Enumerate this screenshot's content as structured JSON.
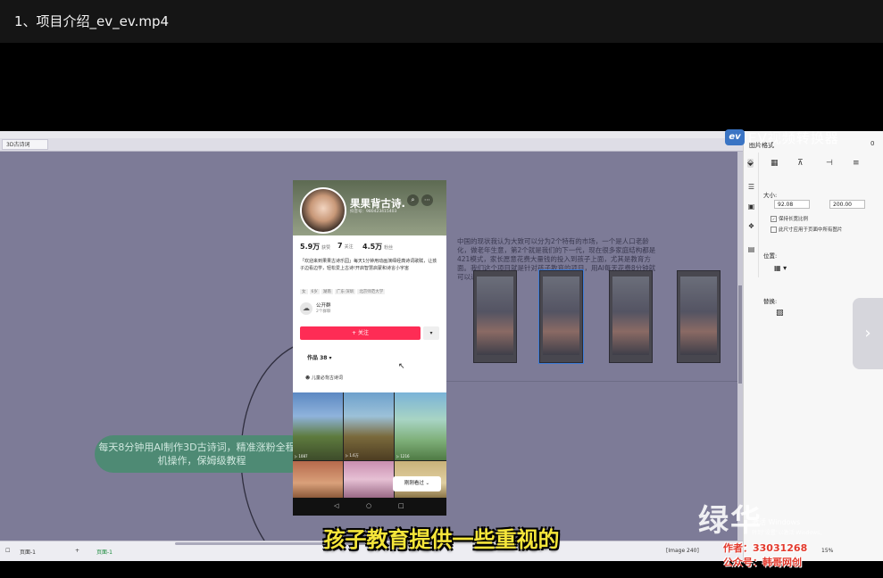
{
  "player": {
    "title": "1、项目介绍_ev_ev.mp4"
  },
  "editor": {
    "doc_tab": "3D古诗词",
    "paragraph": "中国的现状我认为大致可以分为2个特有的市场，一个是人口老龄化，做老年生意，第2个就是我们的下一代，现在很多家庭结构都是421模式，家长愿意花费大量钱的投入到孩子上面，尤其是教育方面。我们这个项目就是针对孩子教育的项目，用AI每天花费8分钟就可以进行变现。",
    "mindmap_node": "每天8分钟用AI制作3D古诗词，精准涨粉全程手机操作，保姆级教程",
    "status_bar": {
      "page_dropdown": "页面-1",
      "page_tab": "页面-1",
      "image_info": "[Image 240]",
      "zoom": "15%"
    }
  },
  "right_panel": {
    "title": "图片格式",
    "size_label": "大小:",
    "width_value": "92.08",
    "height_value": "200.00",
    "lock_ratio": "保持长宽比例",
    "scale_option": "此尺寸应用于页面中所有图片",
    "position_label": "位置:",
    "replace_label": "替换:"
  },
  "phone": {
    "account_name": "果果背古诗.",
    "account_id": "抖音号：980423415403",
    "stats": [
      {
        "num": "5.9万",
        "label": "获赞"
      },
      {
        "num": "7",
        "label": "关注"
      },
      {
        "num": "4.5万",
        "label": "粉丝"
      }
    ],
    "bio": "「欢迎来到果果古诗乐园」每天1分钟用动画演绎经典诗词歌赋，让孩子边看边学，轻松爱上古诗!开启智慧启蒙和诗言小宇宙",
    "tags": [
      "女",
      "6岁",
      "湖南",
      "广东·深圳",
      "北京师范大学"
    ],
    "group_name": "公开群",
    "group_sub": "2个群聊",
    "follow_label": "+ 关注",
    "more_label": "▾",
    "works_label": "作品 38 ▾",
    "playlist_label": "儿童必背古诗词",
    "just_viewed": "刚刚看过 ⌄",
    "cells": [
      {
        "caption": "▷ 1087"
      },
      {
        "caption": "▷ 1.6万"
      },
      {
        "caption": "▷ 1216"
      }
    ],
    "nav": [
      "◁",
      "○",
      "□"
    ]
  },
  "overlays": {
    "ev_watermark": "EV视频转换器",
    "ev_logo": "ev",
    "subtitle": "孩子教育提供一些重视的",
    "big_watermark": "绿华",
    "win_activate": "激活 Windows",
    "win_activate_sub": "转到\"设置\"以激活 Windows。",
    "red_line1": "作者：33031268",
    "red_line2": "公众号：韩哥网创"
  },
  "icons": {
    "next": "chevron-right-icon"
  }
}
